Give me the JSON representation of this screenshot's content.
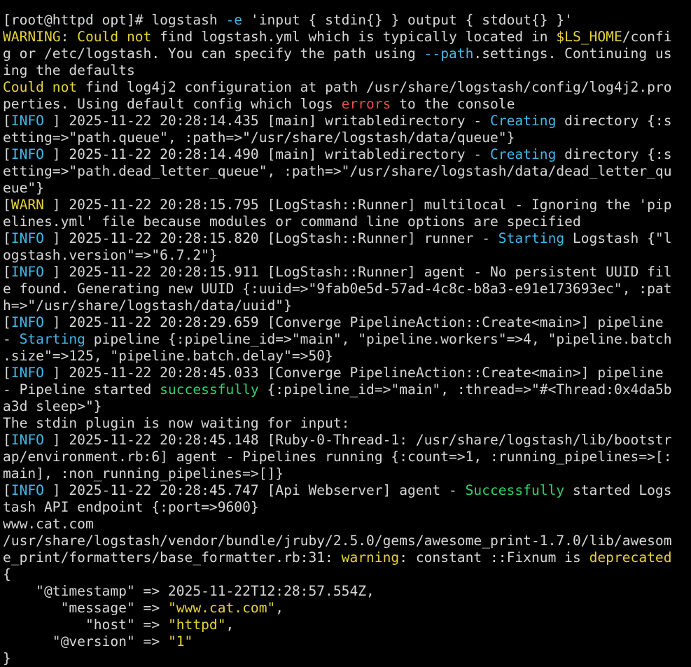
{
  "colors": {
    "background": "#000000",
    "text": "#d7d7d7",
    "yellow": "#e6d23a",
    "cyan": "#41b8e8",
    "red": "#e84e4e",
    "green": "#2fd46a"
  },
  "lines": [
    [
      {
        "t": "  ",
        "c": "w"
      }
    ],
    [
      {
        "t": "[root@httpd opt]# logstash ",
        "c": "w"
      },
      {
        "t": "-e",
        "c": "c"
      },
      {
        "t": " 'input { stdin{} } output { stdout{} }'",
        "c": "w"
      }
    ],
    [
      {
        "t": "WARNING",
        "c": "y"
      },
      {
        "t": ": ",
        "c": "w"
      },
      {
        "t": "Could not",
        "c": "y"
      },
      {
        "t": " find logstash.yml which is typically located in ",
        "c": "w"
      },
      {
        "t": "$LS_HOME",
        "c": "y"
      },
      {
        "t": "/confi",
        "c": "w"
      }
    ],
    [
      {
        "t": "g or /etc/logstash. You can specify the path using ",
        "c": "w"
      },
      {
        "t": "--path",
        "c": "c"
      },
      {
        "t": ".settings. Continuing us",
        "c": "w"
      }
    ],
    [
      {
        "t": "ing the defaults",
        "c": "w"
      }
    ],
    [
      {
        "t": "Could not",
        "c": "y"
      },
      {
        "t": " find log4j2 configuration at path /usr/share/logstash/config/log4j2.pro",
        "c": "w"
      }
    ],
    [
      {
        "t": "perties. Using default config which logs ",
        "c": "w"
      },
      {
        "t": "errors",
        "c": "r"
      },
      {
        "t": " to the console",
        "c": "w"
      }
    ],
    [
      {
        "t": "[",
        "c": "w"
      },
      {
        "t": "INFO",
        "c": "c"
      },
      {
        "t": " ] 2025-11-22 20:28:14.435 [main] writabledirectory - ",
        "c": "w"
      },
      {
        "t": "Creating",
        "c": "c"
      },
      {
        "t": " directory {:s",
        "c": "w"
      }
    ],
    [
      {
        "t": "etting=>\"path.queue\", :path=>\"/usr/share/logstash/data/queue\"}",
        "c": "w"
      }
    ],
    [
      {
        "t": "[",
        "c": "w"
      },
      {
        "t": "INFO",
        "c": "c"
      },
      {
        "t": " ] 2025-11-22 20:28:14.490 [main] writabledirectory - ",
        "c": "w"
      },
      {
        "t": "Creating",
        "c": "c"
      },
      {
        "t": " directory {:s",
        "c": "w"
      }
    ],
    [
      {
        "t": "etting=>\"path.dead_letter_queue\", :path=>\"/usr/share/logstash/data/dead_letter_qu",
        "c": "w"
      }
    ],
    [
      {
        "t": "eue\"}",
        "c": "w"
      }
    ],
    [
      {
        "t": "[",
        "c": "w"
      },
      {
        "t": "WARN",
        "c": "y"
      },
      {
        "t": " ] 2025-11-22 20:28:15.795 [LogStash::Runner] multilocal - Ignoring the 'pip",
        "c": "w"
      }
    ],
    [
      {
        "t": "elines.yml' file because modules or command line options are specified",
        "c": "w"
      }
    ],
    [
      {
        "t": "[",
        "c": "w"
      },
      {
        "t": "INFO",
        "c": "c"
      },
      {
        "t": " ] 2025-11-22 20:28:15.820 [LogStash::Runner] runner - ",
        "c": "w"
      },
      {
        "t": "Starting",
        "c": "c"
      },
      {
        "t": " Logstash {\"l",
        "c": "w"
      }
    ],
    [
      {
        "t": "ogstash.version\"=>\"6.7.2\"}",
        "c": "w"
      }
    ],
    [
      {
        "t": "[",
        "c": "w"
      },
      {
        "t": "INFO",
        "c": "c"
      },
      {
        "t": " ] 2025-11-22 20:28:15.911 [LogStash::Runner] agent - No persistent UUID fil",
        "c": "w"
      }
    ],
    [
      {
        "t": "e found. Generating new UUID {:uuid=>\"9fab0e5d-57ad-4c8c-b8a3-e91e173693ec\", :pat",
        "c": "w"
      }
    ],
    [
      {
        "t": "h=>\"/usr/share/logstash/data/uuid\"}",
        "c": "w"
      }
    ],
    [
      {
        "t": "[",
        "c": "w"
      },
      {
        "t": "INFO",
        "c": "c"
      },
      {
        "t": " ] 2025-11-22 20:28:29.659 [Converge PipelineAction::Create<main>] pipeline",
        "c": "w"
      }
    ],
    [
      {
        "t": "- ",
        "c": "w"
      },
      {
        "t": "Starting",
        "c": "c"
      },
      {
        "t": " pipeline {:pipeline_id=>\"main\", \"pipeline.workers\"=>4, \"pipeline.batch",
        "c": "w"
      }
    ],
    [
      {
        "t": ".size\"=>125, \"pipeline.batch.delay\"=>50}",
        "c": "w"
      }
    ],
    [
      {
        "t": "[",
        "c": "w"
      },
      {
        "t": "INFO",
        "c": "c"
      },
      {
        "t": " ] 2025-11-22 20:28:45.033 [Converge PipelineAction::Create<main>] pipeline",
        "c": "w"
      }
    ],
    [
      {
        "t": "- Pipeline started ",
        "c": "w"
      },
      {
        "t": "successfully",
        "c": "g"
      },
      {
        "t": " {:pipeline_id=>\"main\", :thread=>\"#<Thread:0x4da5b",
        "c": "w"
      }
    ],
    [
      {
        "t": "a3d sleep>\"}",
        "c": "w"
      }
    ],
    [
      {
        "t": "The stdin plugin is now waiting for input:",
        "c": "w"
      }
    ],
    [
      {
        "t": "[",
        "c": "w"
      },
      {
        "t": "INFO",
        "c": "c"
      },
      {
        "t": " ] 2025-11-22 20:28:45.148 [Ruby-0-Thread-1: /usr/share/logstash/lib/bootstr",
        "c": "w"
      }
    ],
    [
      {
        "t": "ap/environment.rb:6] agent - Pipelines running {:count=>1, :running_pipelines=>[:",
        "c": "w"
      }
    ],
    [
      {
        "t": "main], :non_running_pipelines=>[]}",
        "c": "w"
      }
    ],
    [
      {
        "t": "[",
        "c": "w"
      },
      {
        "t": "INFO",
        "c": "c"
      },
      {
        "t": " ] 2025-11-22 20:28:45.747 [Api Webserver] agent - ",
        "c": "w"
      },
      {
        "t": "Successfully",
        "c": "g"
      },
      {
        "t": " started Logs",
        "c": "w"
      }
    ],
    [
      {
        "t": "tash API endpoint {:port=>9600}",
        "c": "w"
      }
    ],
    [
      {
        "t": "www.cat.com",
        "c": "w"
      }
    ],
    [
      {
        "t": "/usr/share/logstash/vendor/bundle/jruby/2.5.0/gems/awesome_print-1.7.0/lib/awesom",
        "c": "w"
      }
    ],
    [
      {
        "t": "e_print/formatters/base_formatter.rb:31: ",
        "c": "w"
      },
      {
        "t": "warning",
        "c": "y"
      },
      {
        "t": ": constant ::Fixnum is ",
        "c": "w"
      },
      {
        "t": "deprecated",
        "c": "y"
      }
    ],
    [
      {
        "t": "{",
        "c": "w"
      }
    ],
    [
      {
        "t": "    \"@timestamp\" => 2025-11-22T12:28:57.554Z,",
        "c": "w"
      }
    ],
    [
      {
        "t": "       \"message\" => ",
        "c": "w"
      },
      {
        "t": "\"www.cat.com\"",
        "c": "y"
      },
      {
        "t": ",",
        "c": "w"
      }
    ],
    [
      {
        "t": "          \"host\" => ",
        "c": "w"
      },
      {
        "t": "\"httpd\"",
        "c": "y"
      },
      {
        "t": ",",
        "c": "w"
      }
    ],
    [
      {
        "t": "      \"@version\" => ",
        "c": "w"
      },
      {
        "t": "\"1\"",
        "c": "y"
      }
    ],
    [
      {
        "t": "}",
        "c": "w"
      }
    ]
  ]
}
